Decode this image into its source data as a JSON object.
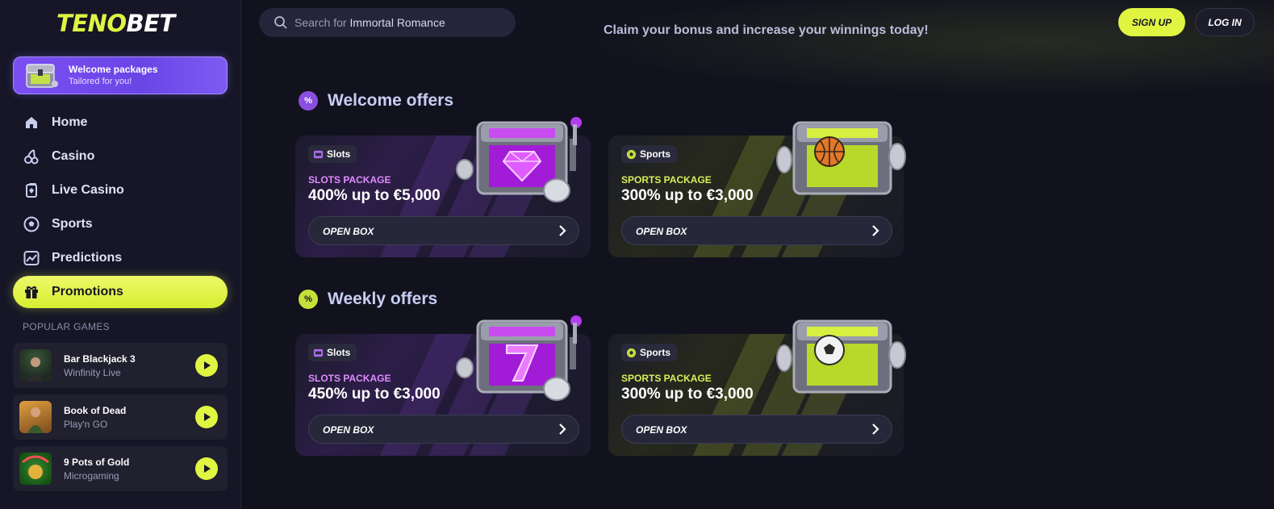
{
  "sidebar": {
    "logo_main": "TENO",
    "logo_tail": "BET",
    "welcome": {
      "title": "Welcome packages",
      "subtitle": "Tailored for you!"
    },
    "nav": [
      {
        "label": "Home",
        "icon": "home-icon"
      },
      {
        "label": "Casino",
        "icon": "cherries-icon"
      },
      {
        "label": "Live Casino",
        "icon": "cards-icon"
      },
      {
        "label": "Sports",
        "icon": "soccer-ball-icon"
      },
      {
        "label": "Predictions",
        "icon": "chart-icon"
      },
      {
        "label": "Promotions",
        "icon": "gift-icon",
        "active": true
      }
    ],
    "popular_title": "POPULAR GAMES",
    "games": [
      {
        "name": "Bar Blackjack 3",
        "provider": "Winfinity Live"
      },
      {
        "name": "Book of Dead",
        "provider": "Play'n GO"
      },
      {
        "name": "9 Pots of Gold",
        "provider": "Microgaming"
      }
    ]
  },
  "header": {
    "search_prefix": "Search for ",
    "search_term": "Immortal Romance",
    "tagline": "Claim your bonus and increase your winnings today!",
    "signup": "SIGN UP",
    "login": "LOG IN"
  },
  "welcome_offers": {
    "badge": "%",
    "title": "Welcome offers",
    "cards": [
      {
        "tag": "Slots",
        "package": "SLOTS PACKAGE",
        "amount": "400% up to €5,000",
        "button": "OPEN BOX"
      },
      {
        "tag": "Sports",
        "package": "SPORTS PACKAGE",
        "amount": "300% up to €3,000",
        "button": "OPEN BOX"
      }
    ]
  },
  "weekly_offers": {
    "badge": "%",
    "title": "Weekly offers",
    "cards": [
      {
        "tag": "Slots",
        "package": "SLOTS PACKAGE",
        "amount": "450% up to €3,000",
        "button": "OPEN BOX"
      },
      {
        "tag": "Sports",
        "package": "SPORTS PACKAGE",
        "amount": "300% up to €3,000",
        "button": "OPEN BOX"
      }
    ]
  },
  "colors": {
    "accent": "#dff542",
    "purple": "#7b4ff2",
    "background": "#12121e"
  }
}
